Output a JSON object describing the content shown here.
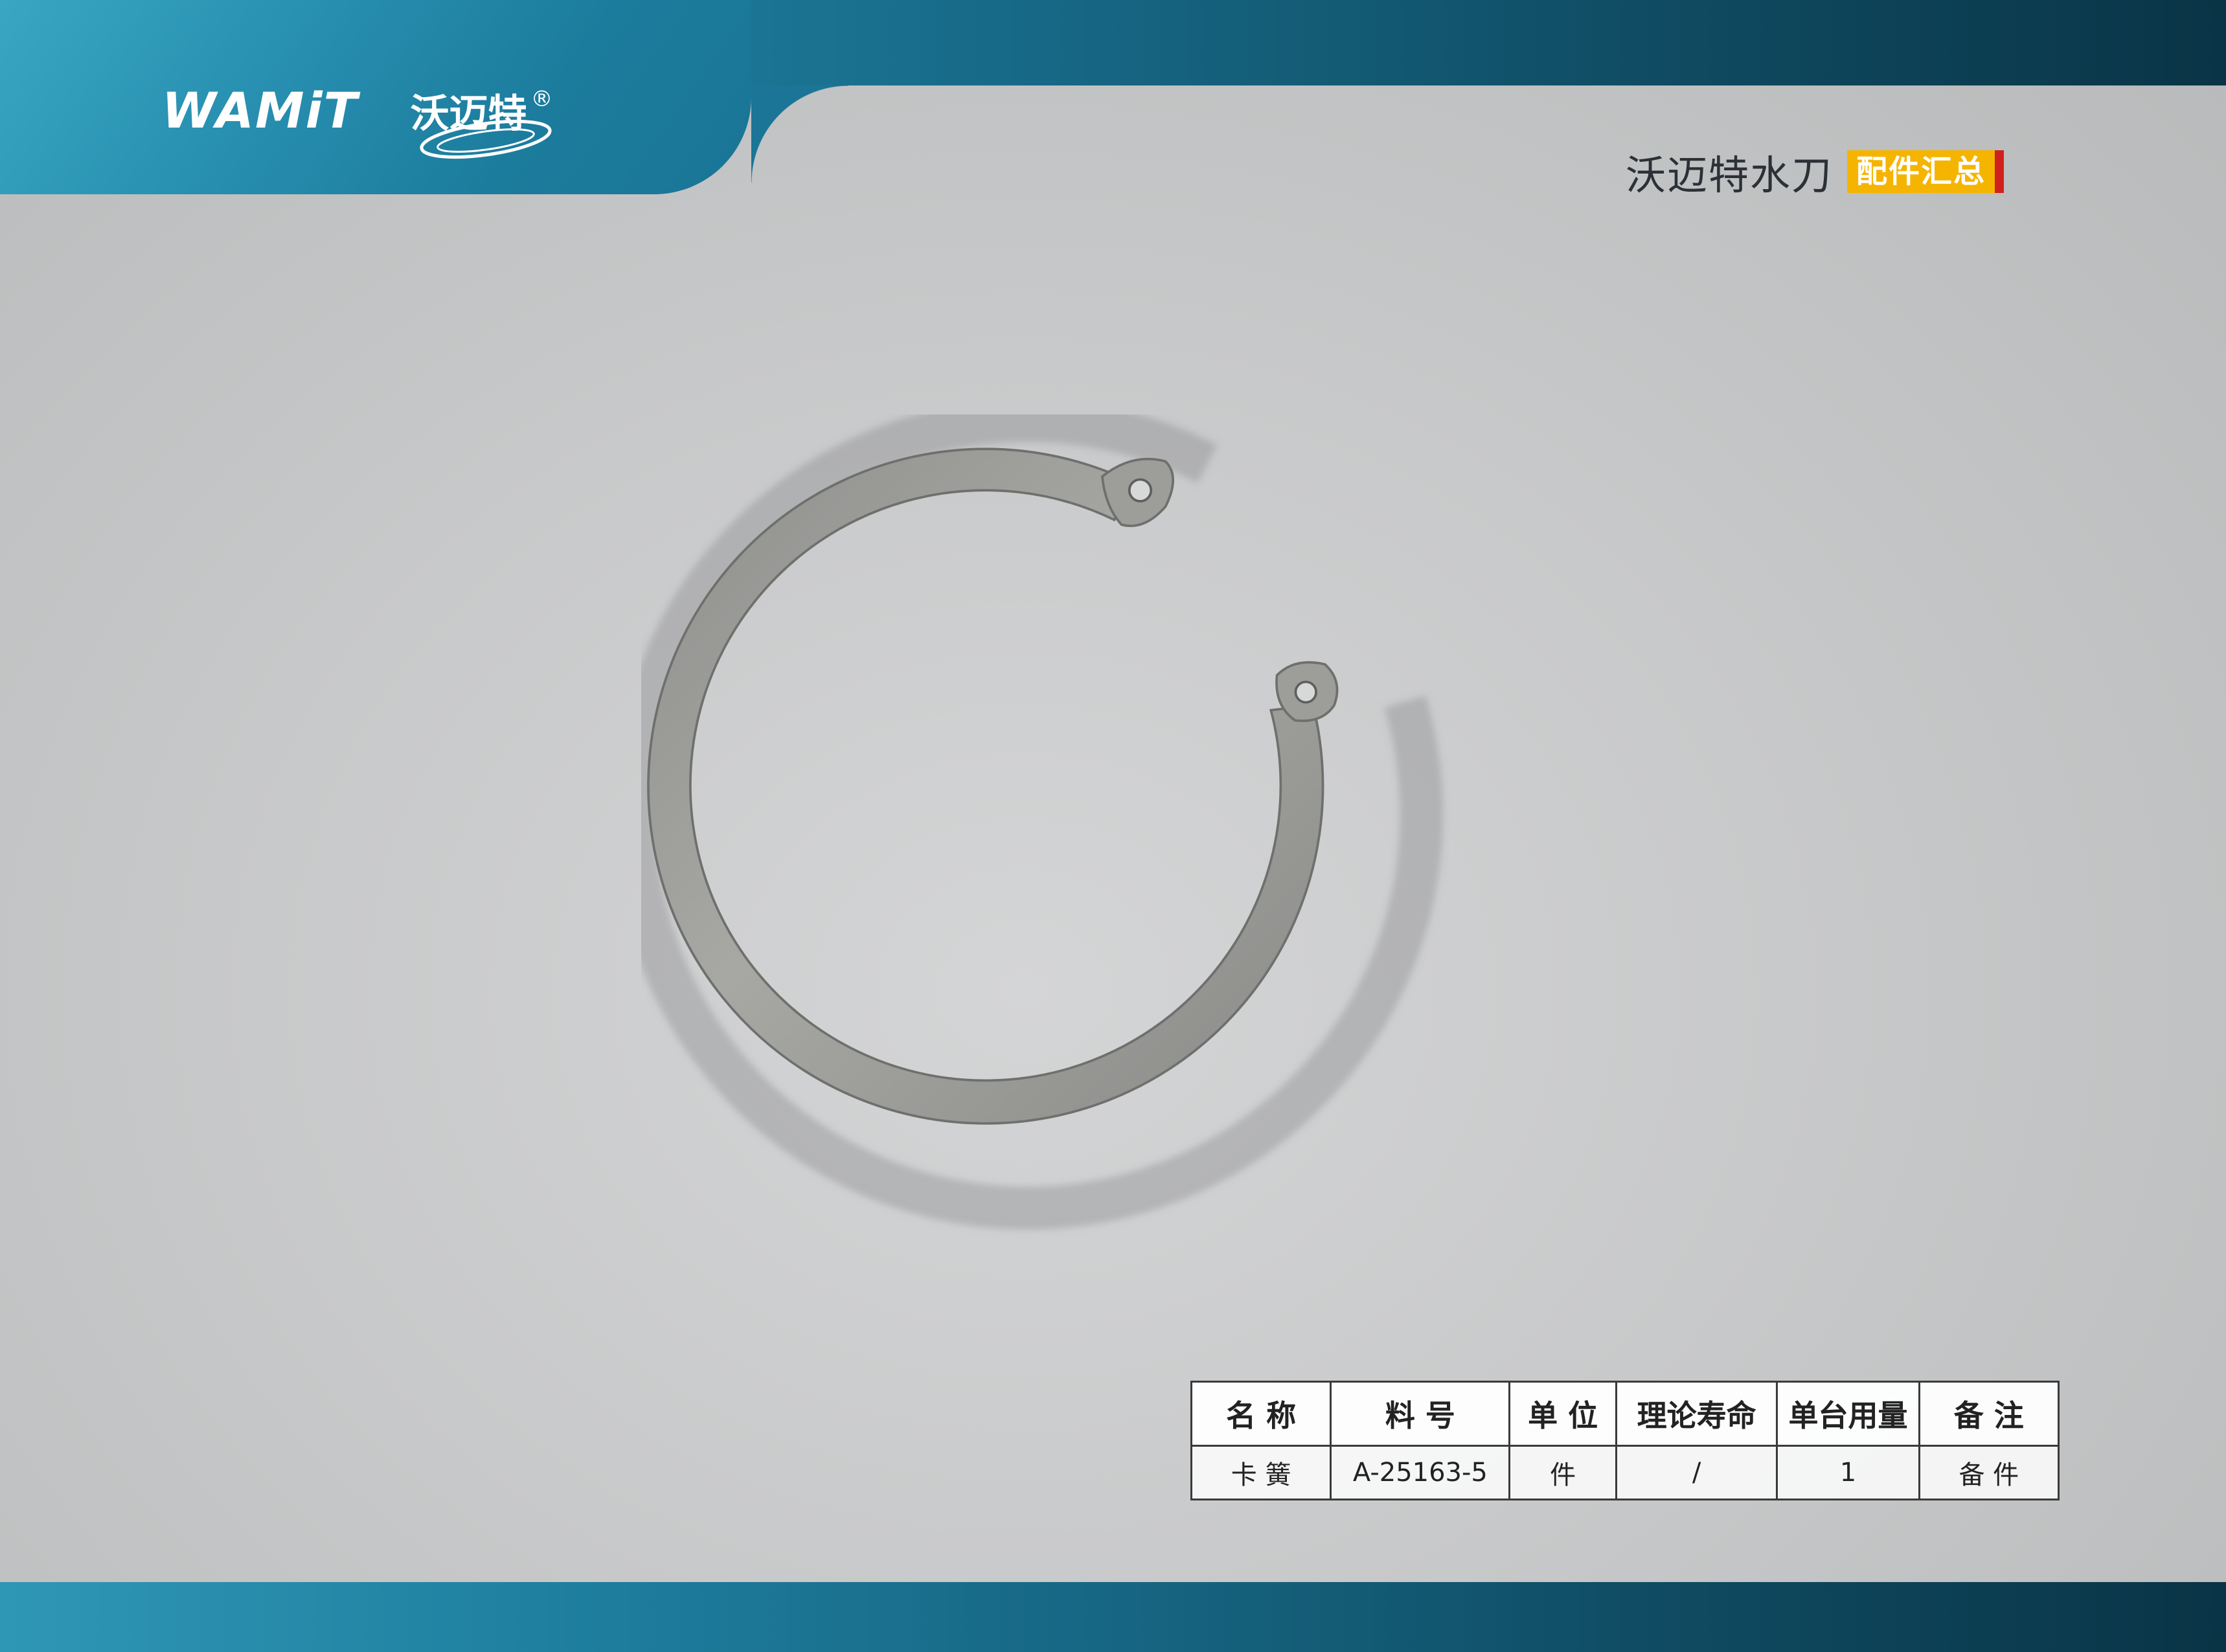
{
  "brand": {
    "logo_wordmark": "WAMiT",
    "logo_cn": "沃迈特",
    "registered_mark": "®"
  },
  "header": {
    "title": "沃迈特水刀",
    "badge": "配件汇总"
  },
  "colors": {
    "band_primary": "#1f7f9f",
    "band_dark": "#0a3446",
    "badge_bg": "#f5b400",
    "badge_accent": "#d0211c",
    "product_metal": "#9a9a96"
  },
  "product": {
    "image_icon": "snap-ring-image"
  },
  "table": {
    "headers": [
      "名 称",
      "料 号",
      "单 位",
      "理论寿命",
      "单台用量",
      "备 注"
    ],
    "rows": [
      [
        "卡  簧",
        "A-25163-5",
        "件",
        "/",
        "1",
        "备 件"
      ]
    ]
  }
}
